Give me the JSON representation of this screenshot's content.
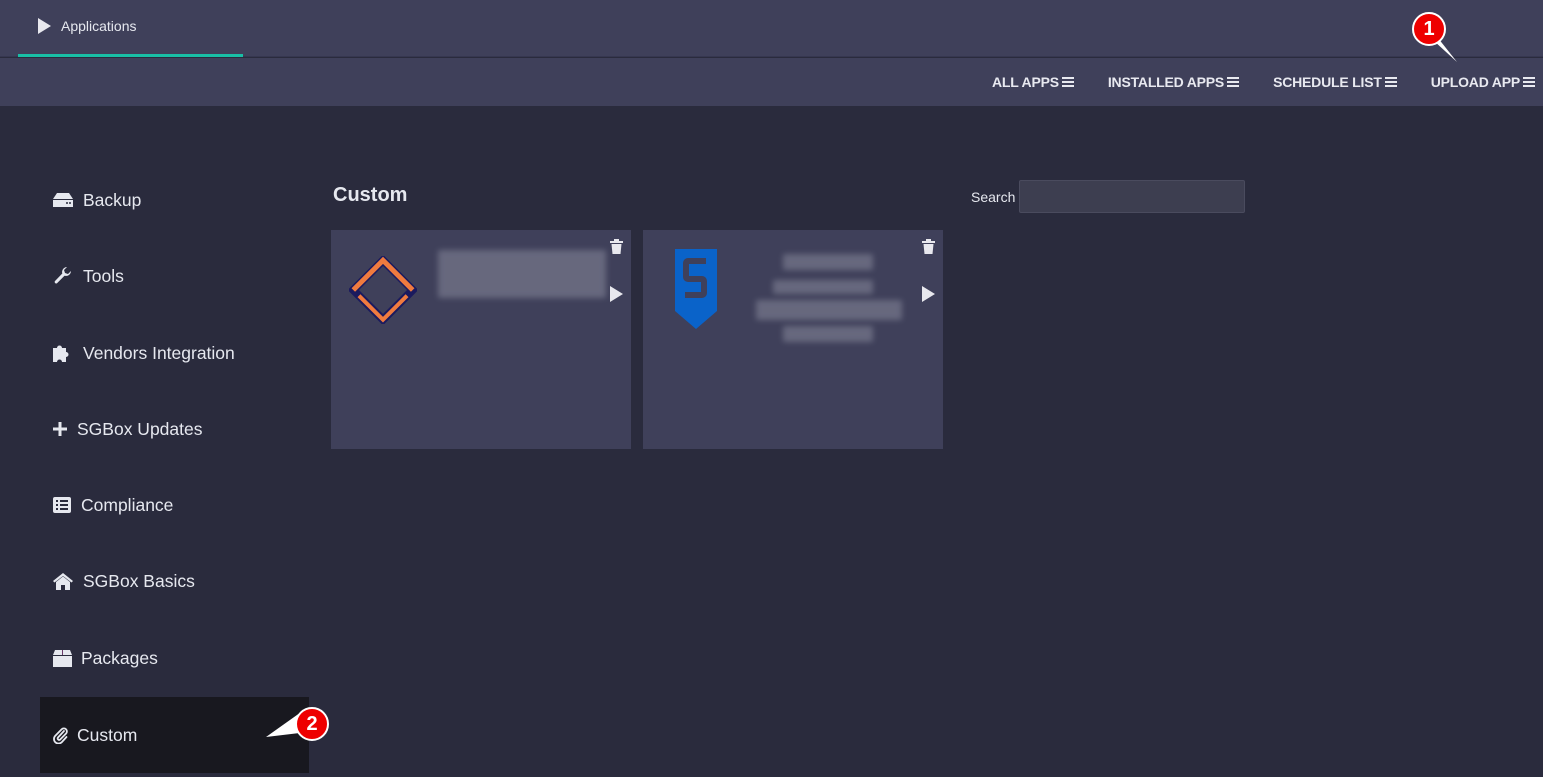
{
  "top_tab": {
    "label": "Applications",
    "icon": "play-icon",
    "accent": "#19bfa6"
  },
  "subnav": [
    {
      "label": "ALL APPS",
      "icon": "menu-icon"
    },
    {
      "label": "INSTALLED APPS",
      "icon": "menu-icon"
    },
    {
      "label": "SCHEDULE LIST",
      "icon": "menu-icon"
    },
    {
      "label": "UPLOAD APP",
      "icon": "menu-icon"
    }
  ],
  "sidebar": {
    "items": [
      {
        "label": "Backup",
        "icon": "hdd-icon"
      },
      {
        "label": "Tools",
        "icon": "wrench-icon"
      },
      {
        "label": "Vendors Integration",
        "icon": "puzzle-icon"
      },
      {
        "label": "SGBox Updates",
        "icon": "plus-icon"
      },
      {
        "label": "Compliance",
        "icon": "list-icon"
      },
      {
        "label": "SGBox Basics",
        "icon": "home-icon"
      },
      {
        "label": "Packages",
        "icon": "box-icon"
      },
      {
        "label": "Custom",
        "icon": "paperclip-icon",
        "active": true
      }
    ]
  },
  "main": {
    "title": "Custom",
    "search": {
      "label": "Search",
      "value": "",
      "placeholder": ""
    },
    "cards": [
      {
        "logo": "diamond-logo",
        "text": "[blurred]",
        "actions": [
          "delete",
          "run"
        ]
      },
      {
        "logo": "shield-s-logo",
        "text": "[blurred]",
        "actions": [
          "delete",
          "run"
        ]
      }
    ]
  },
  "annotations": [
    {
      "number": "1",
      "target": "UPLOAD APP"
    },
    {
      "number": "2",
      "target": "Custom"
    }
  ],
  "colors": {
    "badge": "#ee0000",
    "logo_orange": "#f07b3f",
    "logo_navy": "#1b1a5e",
    "logo_blue": "#0a63c9"
  }
}
